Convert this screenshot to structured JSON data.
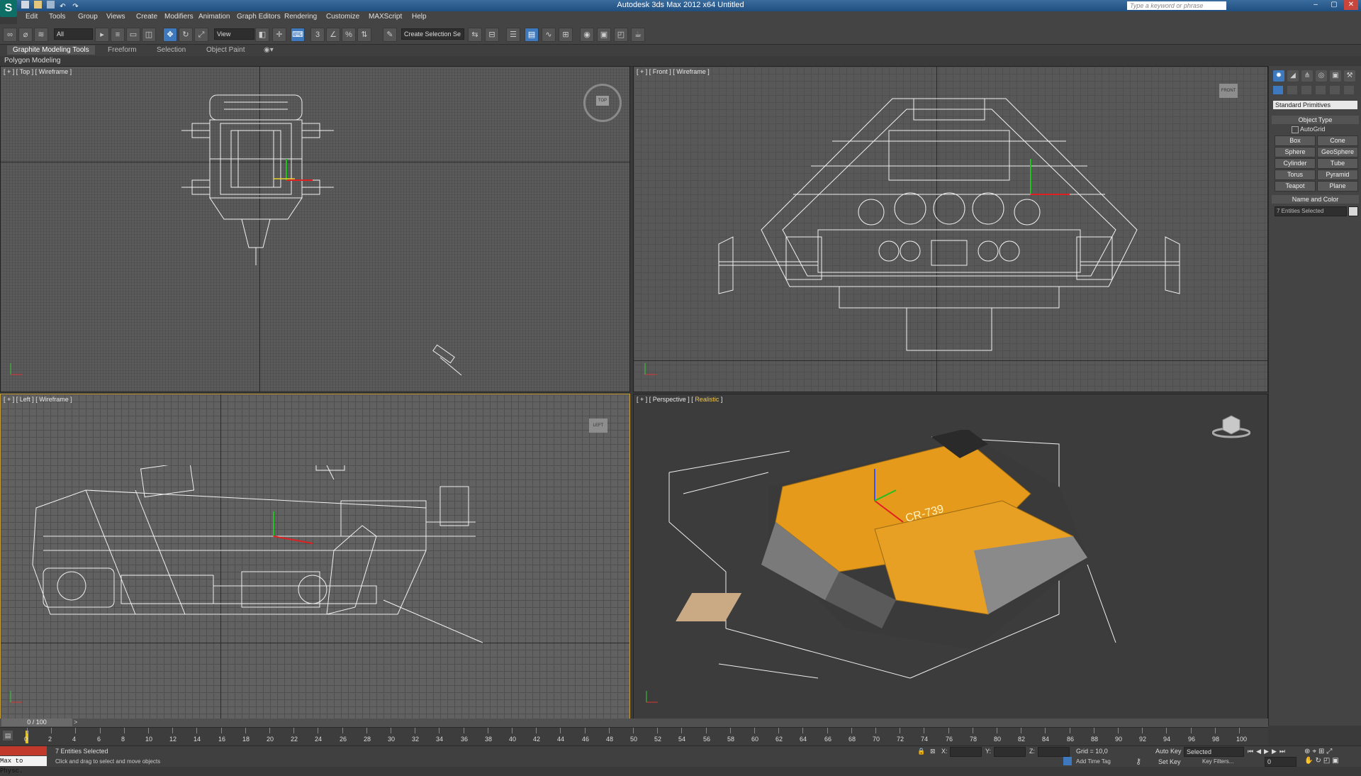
{
  "window": {
    "title": "Autodesk 3ds Max 2012 x64    Untitled",
    "search_placeholder": "Type a keyword or phrase",
    "logo": "S"
  },
  "menu": [
    "Edit",
    "Tools",
    "Group",
    "Views",
    "Create",
    "Modifiers",
    "Animation",
    "Graph Editors",
    "Rendering",
    "Customize",
    "MAXScript",
    "Help"
  ],
  "toolbar": {
    "selection_filter": "All",
    "reference_coord": "View",
    "named_selection": "Create Selection Se",
    "snap_labels": [
      "3",
      "%"
    ]
  },
  "ribbon": {
    "tabs": [
      "Graphite Modeling Tools",
      "Freeform",
      "Selection",
      "Object Paint"
    ],
    "sub_label": "Polygon Modeling"
  },
  "viewports": {
    "top": {
      "label_prefix": "[ + ] [ Top ] [ Wireframe ]",
      "navcube": "TOP"
    },
    "front": {
      "label_prefix": "[ + ] [ Front ] [ Wireframe ]",
      "navcube": "FRONT"
    },
    "left": {
      "label_prefix": "[ + ] [ Left ] [ Wireframe ]",
      "navcube": "LEFT"
    },
    "perspective": {
      "label_prefix": "[ + ] [ Perspective ] [",
      "label_shading": "Realistic",
      "label_suffix": "]",
      "decal": "CR-739"
    }
  },
  "command_panel": {
    "category": "Standard Primitives",
    "object_type_header": "Object Type",
    "autogrid_label": "AutoGrid",
    "primitives": [
      "Box",
      "Cone",
      "Sphere",
      "GeoSphere",
      "Cylinder",
      "Tube",
      "Torus",
      "Pyramid",
      "Teapot",
      "Plane"
    ],
    "name_color_header": "Name and Color",
    "name_value": "7 Entities Selected"
  },
  "timeline": {
    "frame_display": "0 / 100",
    "ticks": [
      "0",
      "2",
      "4",
      "6",
      "8",
      "10",
      "12",
      "14",
      "16",
      "18",
      "20",
      "22",
      "24",
      "26",
      "28",
      "30",
      "32",
      "34",
      "36",
      "38",
      "40",
      "42",
      "44",
      "46",
      "48",
      "50",
      "52",
      "54",
      "56",
      "58",
      "60",
      "62",
      "64",
      "66",
      "68",
      "70",
      "72",
      "74",
      "76",
      "78",
      "80",
      "82",
      "84",
      "86",
      "88",
      "90",
      "92",
      "94",
      "96",
      "98",
      "100"
    ]
  },
  "status": {
    "listener_text": "Max to Physc.",
    "selection_info": "7 Entities Selected",
    "prompt": "Click and drag to select and move objects",
    "x_label": "X:",
    "y_label": "Y:",
    "z_label": "Z:",
    "grid": "Grid = 10,0",
    "auto_key": "Auto Key",
    "set_key": "Set Key",
    "key_mode": "Selected",
    "key_filters": "Key Filters...",
    "add_time_tag": "Add Time Tag",
    "frame_field": "0"
  },
  "colors": {
    "accent": "#3e78bd",
    "ship_orange": "#e59a1c",
    "active_border": "#c9a13a"
  }
}
